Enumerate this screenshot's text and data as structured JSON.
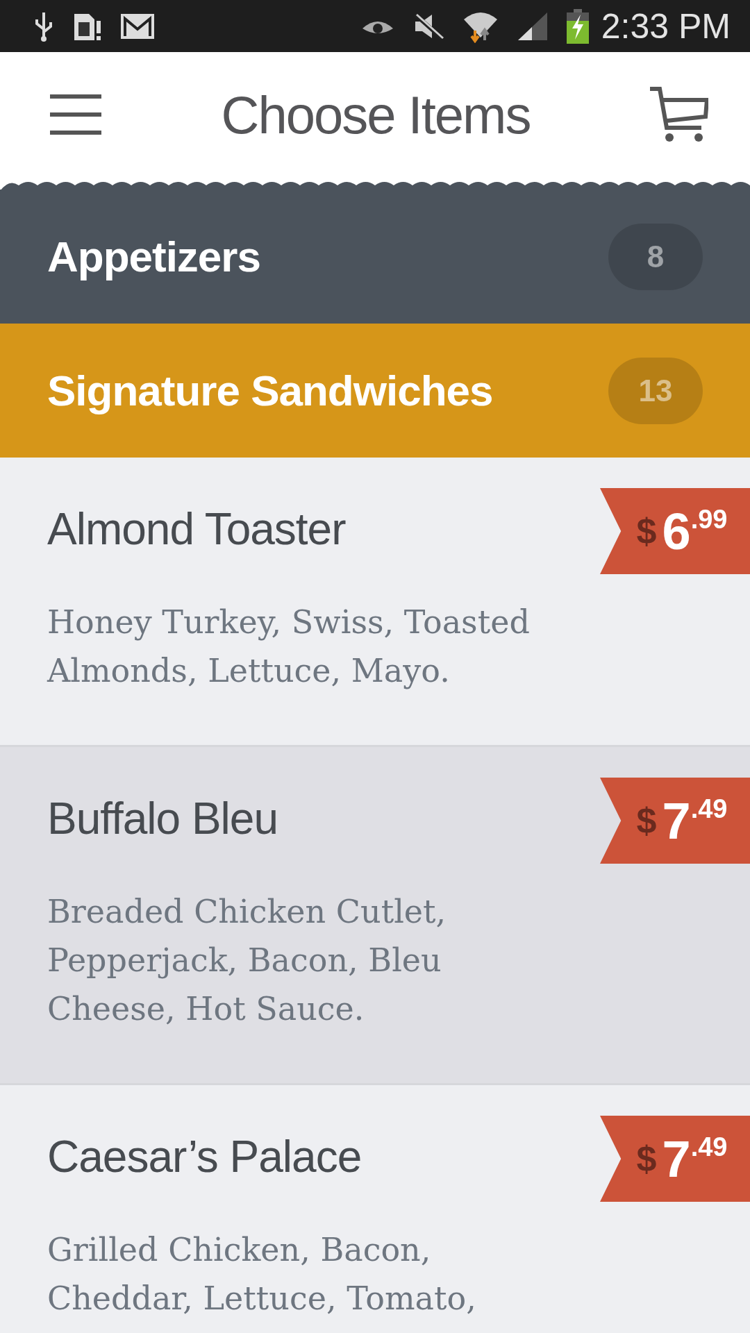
{
  "status_bar": {
    "time": "2:33 PM"
  },
  "header": {
    "title": "Choose Items"
  },
  "categories": [
    {
      "name": "Appetizers",
      "count": "8",
      "color": "#4b535c"
    },
    {
      "name": "Signature Sandwiches",
      "count": "13",
      "color": "#d69619"
    }
  ],
  "items": [
    {
      "name": "Almond Toaster",
      "price": {
        "currency": "$",
        "whole": "6",
        "cents": ".99"
      },
      "description_lines": [
        "Honey Turkey, Swiss, Toasted",
        "Almonds, Lettuce, Mayo."
      ],
      "selected": false
    },
    {
      "name": "Buffalo Bleu",
      "price": {
        "currency": "$",
        "whole": "7",
        "cents": ".49"
      },
      "description_lines": [
        "Breaded Chicken Cutlet,",
        "Pepperjack, Bacon, Bleu",
        "Cheese, Hot Sauce."
      ],
      "selected": true
    },
    {
      "name": "Caesar’s Palace",
      "price": {
        "currency": "$",
        "whole": "7",
        "cents": ".49"
      },
      "description_lines": [
        "Grilled Chicken, Bacon,",
        "Cheddar, Lettuce, Tomato,"
      ],
      "selected": false
    }
  ]
}
